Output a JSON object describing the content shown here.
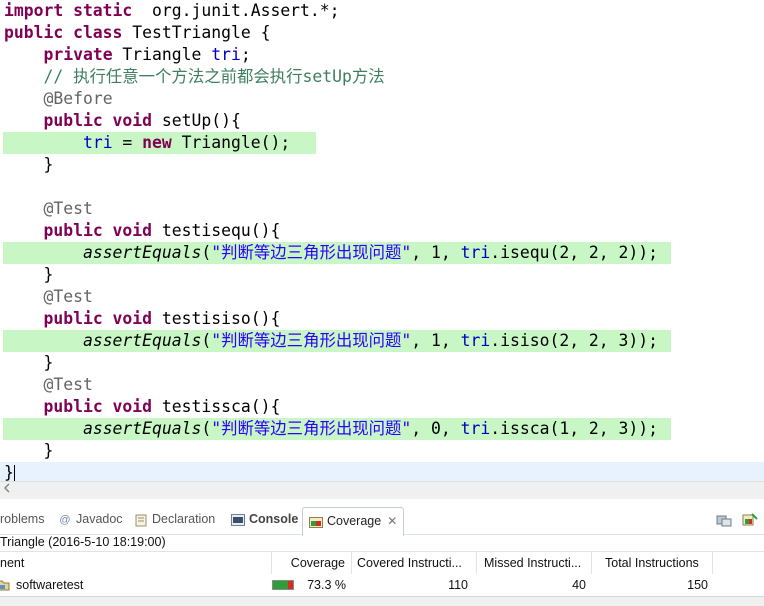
{
  "editor": {
    "lines": [
      [
        [
          "kw",
          "import static"
        ],
        [
          "",
          "  org.junit.Assert.*;"
        ]
      ],
      [
        [
          "kw",
          "public class"
        ],
        [
          "",
          " TestTriangle {"
        ]
      ],
      [
        [
          "",
          "    "
        ],
        [
          "kw",
          "private"
        ],
        [
          "",
          " Triangle "
        ],
        [
          "fld",
          "tri"
        ],
        [
          "",
          ";"
        ]
      ],
      [
        [
          "",
          "    "
        ],
        [
          "cmt",
          "// 执行任意一个方法之前都会执行setUp方法"
        ]
      ],
      [
        [
          "",
          "    "
        ],
        [
          "ann",
          "@Before"
        ]
      ],
      [
        [
          "",
          "    "
        ],
        [
          "kw",
          "public void"
        ],
        [
          "",
          " setUp(){"
        ]
      ],
      [
        [
          "",
          "        "
        ],
        [
          "fld",
          "tri"
        ],
        [
          "",
          " = "
        ],
        [
          "kw",
          "new"
        ],
        [
          "",
          " Triangle();"
        ]
      ],
      [
        [
          "",
          "    }"
        ]
      ],
      [
        [
          "",
          ""
        ]
      ],
      [
        [
          "",
          "    "
        ],
        [
          "ann",
          "@Test"
        ]
      ],
      [
        [
          "",
          "    "
        ],
        [
          "kw",
          "public void"
        ],
        [
          "",
          " testisequ(){"
        ]
      ],
      [
        [
          "",
          "        "
        ],
        [
          "mth",
          "assertEquals"
        ],
        [
          "",
          "("
        ],
        [
          "str",
          "\"判断等边三角形出现问题\""
        ],
        [
          "",
          ", 1, "
        ],
        [
          "fld",
          "tri"
        ],
        [
          "",
          ".isequ(2, 2, 2));"
        ]
      ],
      [
        [
          "",
          "    }"
        ]
      ],
      [
        [
          "",
          "    "
        ],
        [
          "ann",
          "@Test"
        ]
      ],
      [
        [
          "",
          "    "
        ],
        [
          "kw",
          "public void"
        ],
        [
          "",
          " testisiso(){"
        ]
      ],
      [
        [
          "",
          "        "
        ],
        [
          "mth",
          "assertEquals"
        ],
        [
          "",
          "("
        ],
        [
          "str",
          "\"判断等边三角形出现问题\""
        ],
        [
          "",
          ", 1, "
        ],
        [
          "fld",
          "tri"
        ],
        [
          "",
          ".isiso(2, 2, 3));"
        ]
      ],
      [
        [
          "",
          "    }"
        ]
      ],
      [
        [
          "",
          "    "
        ],
        [
          "ann",
          "@Test"
        ]
      ],
      [
        [
          "",
          "    "
        ],
        [
          "kw",
          "public void"
        ],
        [
          "",
          " testissca(){"
        ]
      ],
      [
        [
          "",
          "        "
        ],
        [
          "mth",
          "assertEquals"
        ],
        [
          "",
          "("
        ],
        [
          "str",
          "\"判断等边三角形出现问题\""
        ],
        [
          "",
          ", 0, "
        ],
        [
          "fld",
          "tri"
        ],
        [
          "",
          ".issca(1, 2, 3));"
        ]
      ],
      [
        [
          "",
          "    }"
        ]
      ],
      [
        [
          "",
          "}"
        ]
      ]
    ],
    "covered_lines": [
      6,
      11,
      15,
      19
    ]
  },
  "tabs": [
    {
      "label": "roblems",
      "icon": "problems-icon",
      "active": false
    },
    {
      "label": "Javadoc",
      "icon": "javadoc-icon",
      "active": false
    },
    {
      "label": "Declaration",
      "icon": "declaration-icon",
      "active": false
    },
    {
      "label": "Console",
      "icon": "console-icon",
      "active": false
    },
    {
      "label": "Coverage",
      "icon": "coverage-icon",
      "active": true
    }
  ],
  "close_glyph": "✕",
  "session": "Triangle (2016-5-10 18:19:00)",
  "table": {
    "columns": [
      "nent",
      "Coverage",
      "Covered Instructi...",
      "Missed Instructi...",
      "Total Instructions"
    ],
    "row": {
      "name": "softwaretest",
      "coverage": "73.3 %",
      "coverage_fraction": 0.733,
      "covered": "110",
      "missed": "40",
      "total": "150"
    }
  },
  "colors": {
    "covered_highlight": "#c8f7c5",
    "keyword": "#7f0055",
    "field": "#0000c0",
    "annotation": "#646464",
    "comment": "#3f7f5f",
    "string": "#2a00ff",
    "bar_covered": "#2e9e3a",
    "bar_missed": "#d62d20"
  }
}
